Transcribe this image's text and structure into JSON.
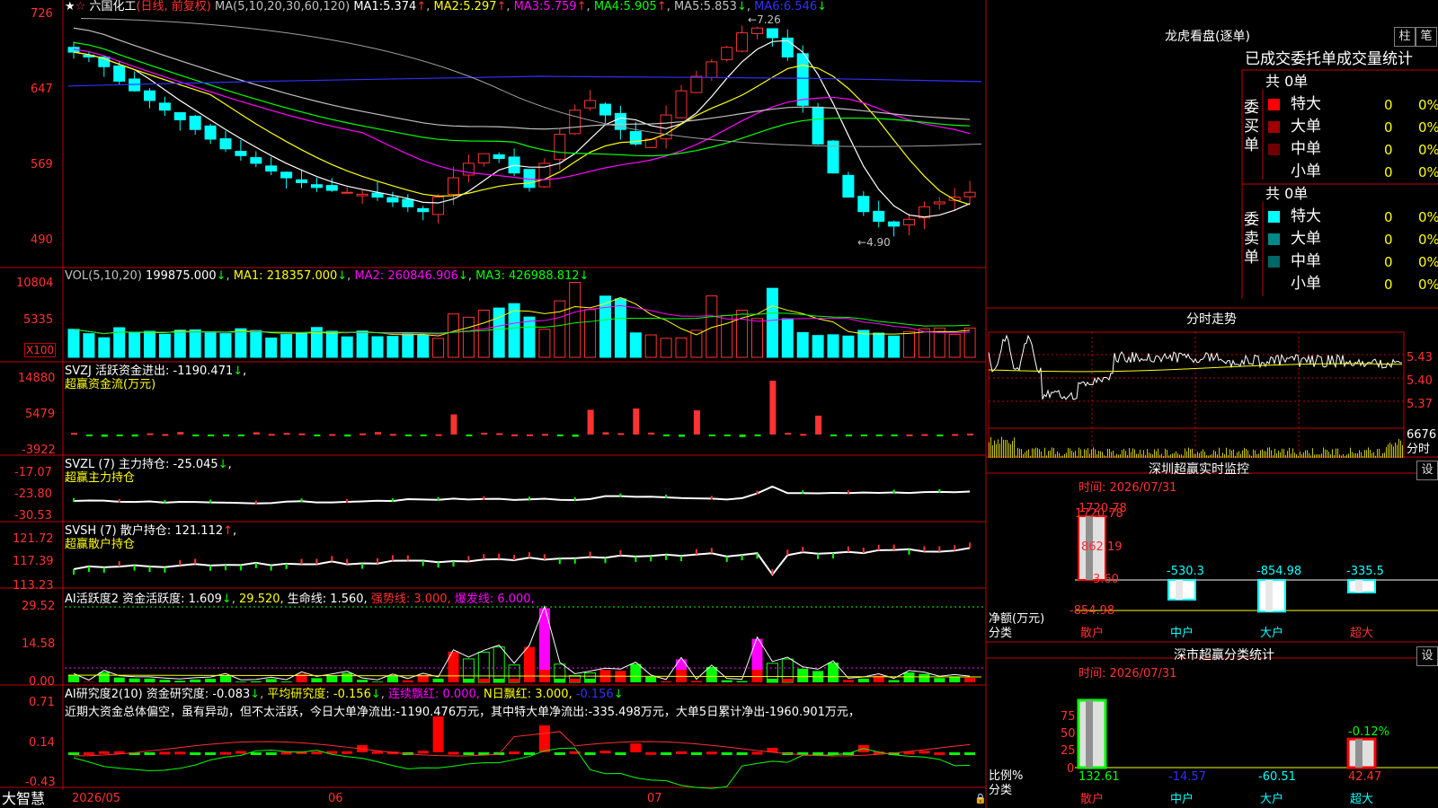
{
  "stock": {
    "name": "六国化工",
    "period": "(日线, 前复权)"
  },
  "app": {
    "brand": "大智慧"
  },
  "colors": {
    "up": "#ff3232",
    "down": "#00ffff",
    "border": "#c00000",
    "ma1": "#ffffff",
    "ma2": "#ffff00",
    "ma3": "#ff00ff",
    "ma4": "#00ff00",
    "ma5": "#c0c0c0",
    "ma6": "#3030ff"
  },
  "price_panel": {
    "axis": [
      "726",
      "647",
      "569",
      "490"
    ],
    "ma_label": "MA(5,10,20,30,60,120)",
    "ma_values": [
      {
        "label": "MA1:",
        "value": "5.374"
      },
      {
        "label": "MA2:",
        "value": "5.297"
      },
      {
        "label": "MA3:",
        "value": "5.759"
      },
      {
        "label": "MA4:",
        "value": "5.905"
      },
      {
        "label": "MA5:",
        "value": "5.853"
      },
      {
        "label": "MA6:",
        "value": "6.546"
      }
    ],
    "high_mark": "7.26",
    "low_mark": "4.90"
  },
  "vol_panel": {
    "axis": [
      "10804",
      "5335"
    ],
    "unit": "X100",
    "label": "VOL(5,10,20)",
    "v": "199875.000",
    "ma1": "MA1: 218357.000",
    "ma2": "MA2: 260846.906",
    "ma3": "MA3: 426988.812"
  },
  "svzj_panel": {
    "axis": [
      "14880",
      "5479",
      "-3922"
    ],
    "label": "SVZJ  活跃资金进出: -1190.471",
    "sub": "超赢资金流(万元)"
  },
  "svzl_panel": {
    "axis": [
      "-17.07",
      "-23.80",
      "-30.53"
    ],
    "label": "SVZL (7) 主力持仓: -25.045",
    "sub": "超赢主力持仓"
  },
  "svsh_panel": {
    "axis": [
      "121.72",
      "117.39",
      "113.23"
    ],
    "label": "SVSH (7) 散户持仓: 121.112",
    "sub": "超赢散户持仓"
  },
  "ai1_panel": {
    "axis": [
      "29.52",
      "14.58",
      "0.00"
    ],
    "label": "AI活跃度2 资金活跃度: 1.609",
    "v2": "29.520,",
    "v3": "生命线: 1.560,",
    "v4": "强势线: 3.000,",
    "v5": "爆发线: 6.000,"
  },
  "ai2_panel": {
    "axis": [
      "0.71",
      "0.14",
      "-0.43"
    ],
    "label": "AI研究度2(10) 资金研究度: -0.083",
    "v2": "平均研究度: -0.156",
    "v3": "连续飘红: 0.000,",
    "v4": "N日飘红: 3.000,",
    "v5": "-0.156",
    "comment": "近期大资金总体偏空，虽有异动，但不太活跃，今日大单净流出:-1190.476万元，其中特大单净流出:-335.498万元，大单5日累计净出-1960.901万元，"
  },
  "date_axis": [
    "2026/05",
    "06",
    "07"
  ],
  "lhb": {
    "title": "龙虎看盘(逐单)",
    "btn1": "柱",
    "btn2": "笔",
    "sub": "已成交委托单成交量统计",
    "buy_label": "委买单",
    "sell_label": "委卖单",
    "count_buy": "共 0单",
    "count_sell": "共 0单",
    "buy_rows": [
      {
        "label": "特大",
        "val": "0",
        "pct": "0%",
        "color": "#ff0000"
      },
      {
        "label": "大单",
        "val": "0",
        "pct": "0%",
        "color": "#a00000"
      },
      {
        "label": "中单",
        "val": "0",
        "pct": "0%",
        "color": "#700000"
      },
      {
        "label": "小单",
        "val": "0",
        "pct": "0%",
        "color": "#000000"
      }
    ],
    "sell_rows": [
      {
        "label": "特大",
        "val": "0",
        "pct": "0%",
        "color": "#00ffff"
      },
      {
        "label": "大单",
        "val": "0",
        "pct": "0%",
        "color": "#008888"
      },
      {
        "label": "中单",
        "val": "0",
        "pct": "0%",
        "color": "#006666"
      },
      {
        "label": "小单",
        "val": "0",
        "pct": "0%",
        "color": "#000000"
      }
    ]
  },
  "intraday": {
    "title": "分时走势",
    "axis": [
      "5.43",
      "5.40",
      "5.37"
    ],
    "vol": "6676",
    "vol_unit": "分时"
  },
  "monitor": {
    "title": "深圳超赢实时监控",
    "btn": "设",
    "time": "时间: 2026/07/31",
    "axis": [
      "1720.78",
      "862.19",
      "3.60",
      "-854.98"
    ],
    "axis_name": "净额(万元)",
    "axis_name2": "分类",
    "bars": [
      {
        "cat": "散户",
        "value": 1720.78,
        "label": "1720.78"
      },
      {
        "cat": "中户",
        "value": -530.3,
        "label": "-530.3"
      },
      {
        "cat": "大户",
        "value": -854.98,
        "label": "-854.98"
      },
      {
        "cat": "超大",
        "value": -335.5,
        "label": "-335.5"
      }
    ]
  },
  "stats": {
    "title": "深市超赢分类统计",
    "btn": "设",
    "time": "时间: 2026/07/31",
    "axis": [
      "75",
      "50",
      "25",
      "0"
    ],
    "axis_name": "比例%",
    "axis_name2": "分类",
    "top_label": "-0.12%",
    "bars": [
      {
        "cat": "散户",
        "value": 132.61,
        "label": "132.61"
      },
      {
        "cat": "中户",
        "value": -14.57,
        "label": "-14.57"
      },
      {
        "cat": "大户",
        "value": -60.51,
        "label": "-60.51"
      },
      {
        "cat": "超大",
        "value": 42.47,
        "label": "42.47"
      }
    ]
  }
}
